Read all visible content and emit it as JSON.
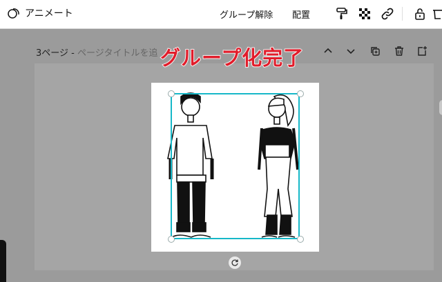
{
  "topbar": {
    "animate_label": "アニメート",
    "ungroup_label": "グループ解除",
    "arrange_label": "配置"
  },
  "page": {
    "label": "3ページ - ",
    "title_placeholder": "ページタイトルを追"
  },
  "overlay_caption": "グループ化完了",
  "colors": {
    "selection": "#16b8c8",
    "caption": "#e11d2b",
    "canvas_bg": "#9b9b9b"
  }
}
